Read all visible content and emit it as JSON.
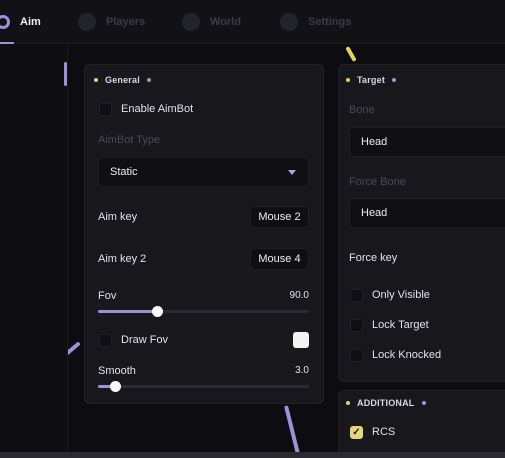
{
  "nav": {
    "tabs": [
      {
        "label": "Aim",
        "icon": "crosshair-icon"
      },
      {
        "label": "Players",
        "icon": "users-icon"
      },
      {
        "label": "World",
        "icon": "globe-icon"
      },
      {
        "label": "Settings",
        "icon": "gear-icon"
      }
    ],
    "active_tab": "Aim"
  },
  "general": {
    "title": "General",
    "enable_aimbot": {
      "label": "Enable AimBot",
      "checked": false
    },
    "aimbot_type": {
      "label": "AimBot Type",
      "value": "Static"
    },
    "aim_key": {
      "label": "Aim key",
      "value": "Mouse 2"
    },
    "aim_key_2": {
      "label": "Aim key 2",
      "value": "Mouse 4"
    },
    "fov": {
      "label": "Fov",
      "value": "90.0",
      "fraction": 0.28
    },
    "draw_fov": {
      "label": "Draw Fov",
      "checked": false,
      "color": "#f2f2f2"
    },
    "smooth": {
      "label": "Smooth",
      "value": "3.0",
      "fraction": 0.08
    }
  },
  "target": {
    "title": "Target",
    "bone": {
      "label": "Bone",
      "value": "Head"
    },
    "force_bone": {
      "label": "Force Bone",
      "value": "Head"
    },
    "force_key": {
      "label": "Force key"
    },
    "only_visible": {
      "label": "Only Visible",
      "checked": false
    },
    "lock_target": {
      "label": "Lock Target",
      "checked": false
    },
    "lock_knocked": {
      "label": "Lock Knocked",
      "checked": false
    }
  },
  "additional": {
    "title": "ADDITIONAL",
    "rcs": {
      "label": "RCS",
      "checked": true
    }
  },
  "colors": {
    "accent": "#9c92d8",
    "dot_yellow": "#e8d35a",
    "checkbox_on": "#e6d57a",
    "panel": "#17171c",
    "background": "#0d0d11"
  }
}
